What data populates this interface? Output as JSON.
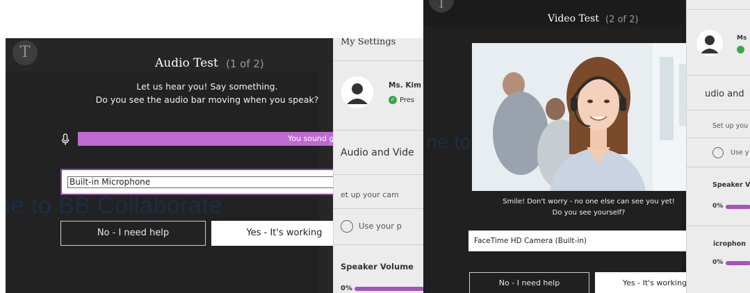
{
  "audio_test": {
    "logo_letter": "T",
    "title": "Audio Test",
    "step": "(1 of 2)",
    "instruction_line1": "Let us hear you! Say something.",
    "instruction_line2": "Do you see the audio bar moving when you speak?",
    "meter_text": "You sound great!",
    "meter_color": "#bf6ad3",
    "device_select_value": "Built-in Microphone",
    "no_button": "No - I need help",
    "yes_button": "Yes - It's working",
    "background_text": "ne to BB Collaborate"
  },
  "audio_side_panel": {
    "title": "My Settings",
    "user_name": "Ms. Kim",
    "user_status": "Pres",
    "section_heading": "Audio and Vide",
    "setup_text": "et up your cam",
    "phone_text": "Use your p",
    "speaker_label": "Speaker Volume",
    "speaker_percent": "0%"
  },
  "video_test": {
    "logo_letter": "T",
    "title": "Video Test",
    "step": "(2 of 2)",
    "caption_line1": "Smile! Don't worry - no one else can see you yet!",
    "caption_line2": "Do you see yourself?",
    "camera_select_value": "FaceTime HD Camera (Built-in)",
    "no_button": "No - I need help",
    "yes_button": "Yes - It's working",
    "background_text": "ne to"
  },
  "video_side_panel": {
    "user_name_partial": "Ms",
    "section_heading": "udio and",
    "setup_text": "Set up you",
    "phone_text": "Use y",
    "speaker_label": "Speaker Vo",
    "speaker_percent": "0%",
    "mic_label": "icrophon",
    "mic_percent": "0%"
  },
  "accent_color": "#a553bd",
  "status_color": "#3aa64a"
}
